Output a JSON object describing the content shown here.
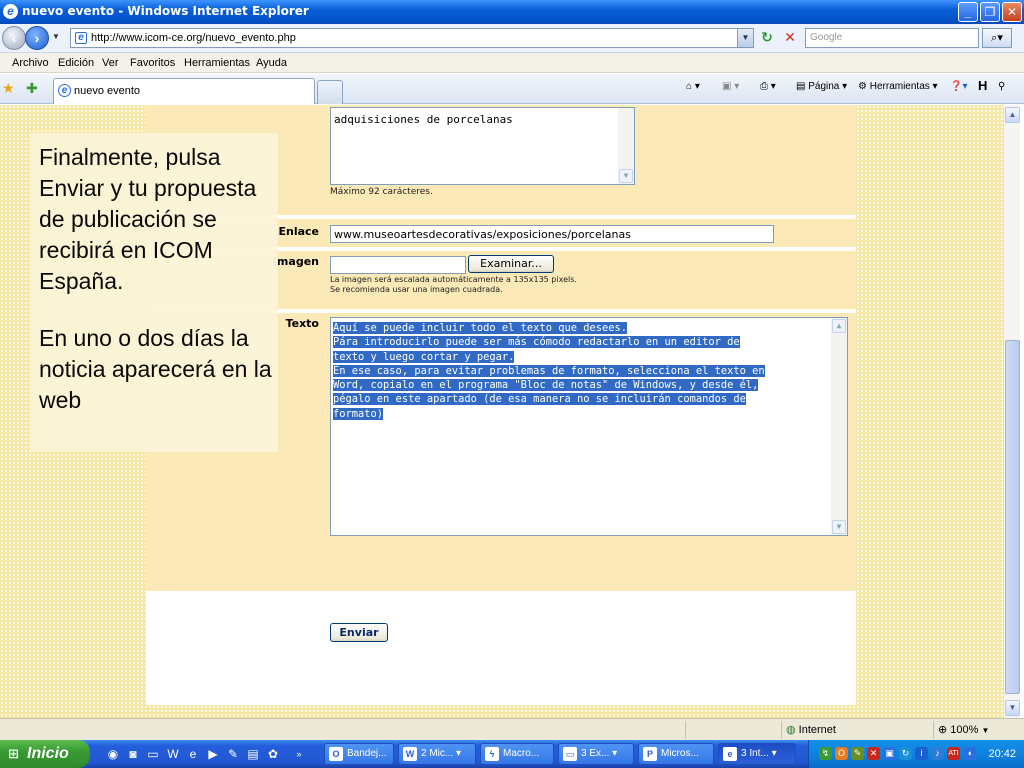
{
  "window": {
    "title": "nuevo evento - Windows Internet Explorer",
    "minimize_icon": "minimize-icon",
    "maximize_icon": "maximize-icon",
    "close_icon": "close-icon"
  },
  "address_bar": {
    "url": "http://www.icom-ce.org/nuevo_evento.php",
    "search_placeholder": "Google"
  },
  "menu": {
    "items": [
      "Archivo",
      "Edición",
      "Ver",
      "Favoritos",
      "Herramientas",
      "Ayuda"
    ]
  },
  "tabs": {
    "active_tab": "nuevo evento"
  },
  "command_bar": {
    "page_label": "Página",
    "tools_label": "Herramientas"
  },
  "form": {
    "description_value": "adquisiciones de porcelanas",
    "description_hint": "Máximo 92 carácteres.",
    "link_label": "Enlace",
    "link_value": "www.museoartesdecorativas/exposiciones/porcelanas",
    "image_label": "Imagen",
    "browse_button": "Examinar...",
    "image_hint_1": "La imagen será escalada automáticamente a 135x135 pixels.",
    "image_hint_2": "Se recomienda usar una imagen cuadrada.",
    "text_label": "Texto",
    "text_lines": [
      "Aquí se puede incluir todo el texto que desees.",
      "Pára introducirlo puede ser más cómodo redactarlo en un editor de",
      "texto y luego cortar y pegar.",
      "En ese caso, para evitar problemas de formato, selecciona el texto en",
      "Word, copialo en el programa \"Bloc de notas\" de Windows, y desde él,",
      "pégalo en este apartado (de esa manera no se incluirán comandos de",
      "formato)"
    ],
    "submit_button": "Enviar"
  },
  "note": {
    "line1": "Finalmente, pulsa Enviar y tu propuesta de publicación se recibirá en ICOM España.",
    "line2": "En uno o dos días la noticia aparecerá en la web"
  },
  "status_bar": {
    "zone": "Internet",
    "zoom": "100%"
  },
  "taskbar": {
    "start_label": "Inicio",
    "items": [
      "Bandej...",
      "2 Mic...",
      "Macro...",
      "3 Ex...",
      "Micros...",
      "3 Int..."
    ],
    "clock": "20:42"
  }
}
